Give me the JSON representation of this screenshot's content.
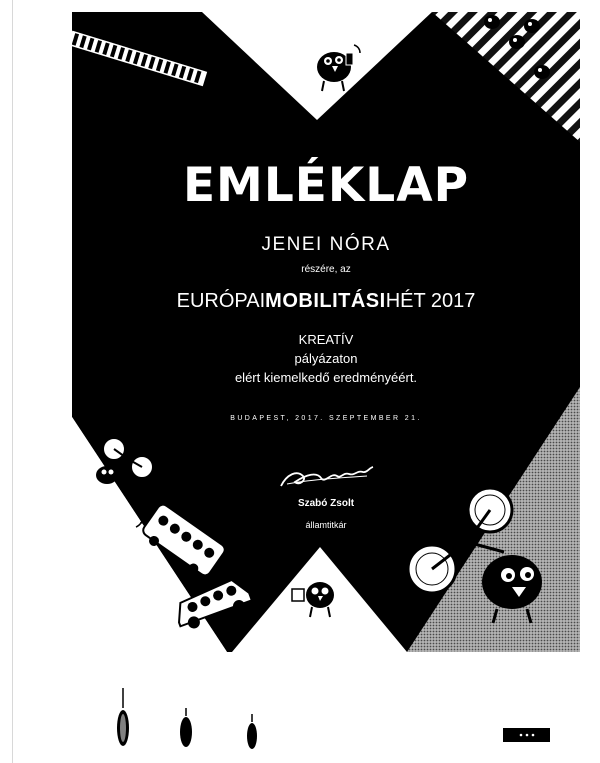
{
  "certificate": {
    "title": "EMLÉKLAP",
    "recipient": "JENEI NÓRA",
    "recipient_suffix": "részére, az",
    "event_prefix": "EURÓPAI",
    "event_bold": "MOBILITÁSI",
    "event_suffix": "HÉT 2017",
    "line_1": "KREATÍV",
    "line_2": "pályázaton",
    "line_3": "elért kiemelkedő eredményéért.",
    "place_date": "BUDAPEST, 2017. SZEPTEMBER 21.",
    "signer_name": "Szabó Zsolt",
    "signer_title": "államtitkár"
  },
  "colors": {
    "background": "#ffffff",
    "ink": "#000000",
    "halftone_gray": "#9a9a9a"
  },
  "icons": {
    "signature": "handwritten-signature",
    "birds": "cartoon-bird-mascot",
    "bicycles": "bicycle",
    "bus": "bus",
    "car": "car",
    "crosswalk": "zebra-crossing"
  }
}
